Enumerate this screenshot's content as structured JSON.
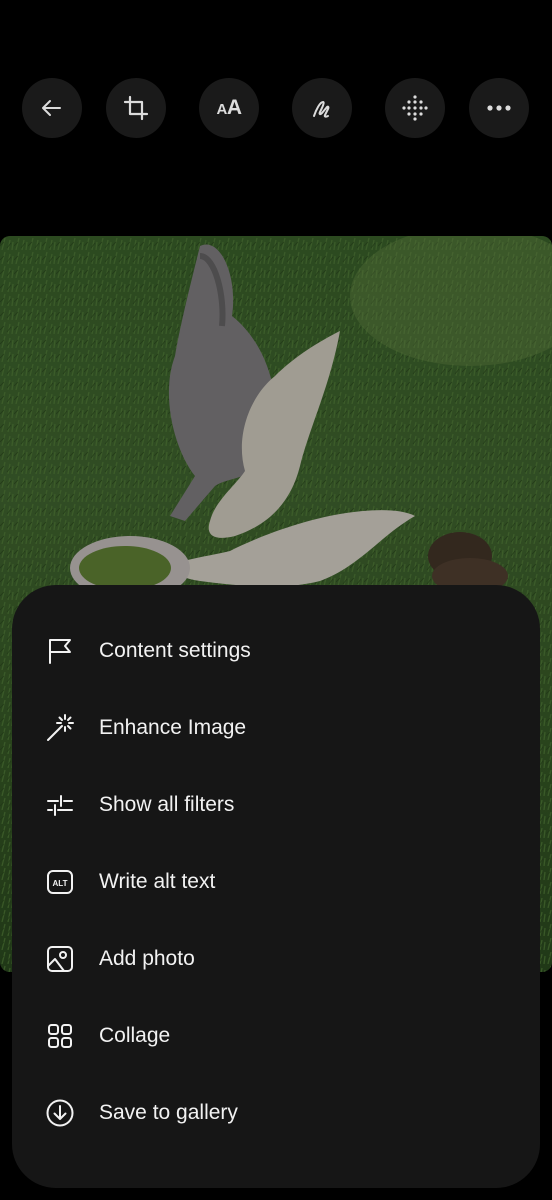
{
  "toolbar": {
    "buttons": [
      {
        "name": "back",
        "icon": "arrow-left-icon"
      },
      {
        "name": "crop",
        "icon": "crop-icon"
      },
      {
        "name": "text",
        "icon": "text-size-icon",
        "label_small": "A",
        "label_big": "A"
      },
      {
        "name": "draw",
        "icon": "scribble-icon"
      },
      {
        "name": "filters",
        "icon": "dot-grid-icon"
      },
      {
        "name": "more",
        "icon": "more-dots-icon"
      }
    ]
  },
  "photo": {
    "subject": "ducks-on-grass"
  },
  "menu": {
    "items": [
      {
        "label": "Content settings",
        "icon": "flag-icon"
      },
      {
        "label": "Enhance Image",
        "icon": "magic-wand-icon"
      },
      {
        "label": "Show all filters",
        "icon": "sliders-icon"
      },
      {
        "label": "Write alt text",
        "icon": "alt-badge-icon",
        "badge_text": "ALT"
      },
      {
        "label": "Add photo",
        "icon": "add-image-icon"
      },
      {
        "label": "Collage",
        "icon": "grid-icon"
      },
      {
        "label": "Save to gallery",
        "icon": "download-circle-icon"
      }
    ]
  },
  "colors": {
    "background": "#000000",
    "sheet": "#161616",
    "button": "#1a1a1a",
    "text": "#f2f2f2",
    "icon": "#dcdcdc"
  }
}
